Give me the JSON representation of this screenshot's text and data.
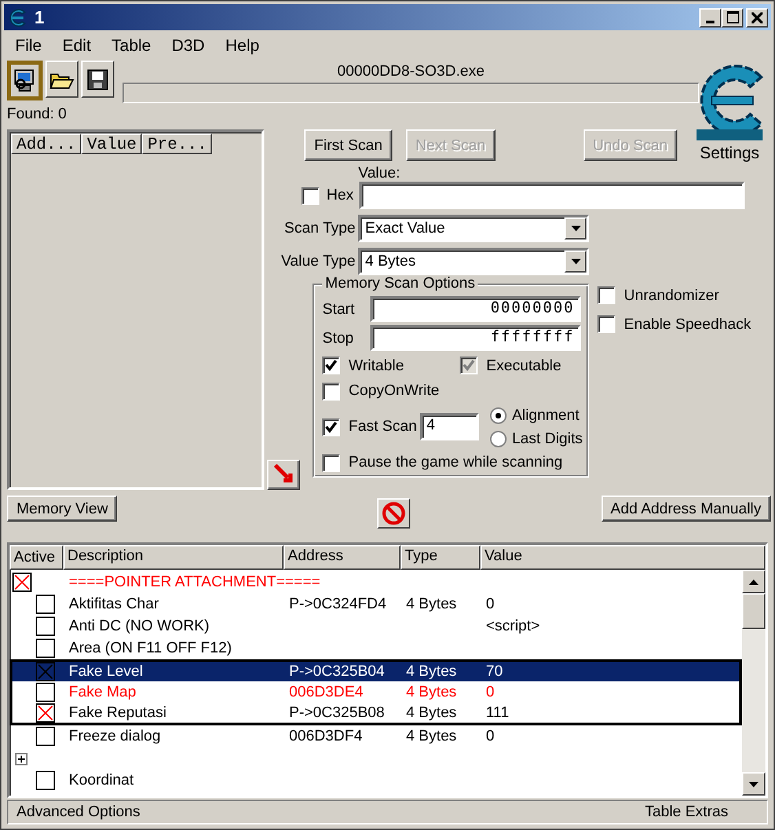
{
  "window": {
    "title": "1"
  },
  "menu": [
    "File",
    "Edit",
    "Table",
    "D3D",
    "Help"
  ],
  "toolbar_buttons": [
    {
      "kind": "process",
      "selected": true
    },
    {
      "kind": "open",
      "selected": false
    },
    {
      "kind": "save",
      "selected": false
    }
  ],
  "process_name": "00000DD8-SO3D.exe",
  "progress": {
    "level": 0
  },
  "found": "Found: 0",
  "settings": "Settings",
  "results_list": {
    "columns": [
      "Add...",
      "Value",
      "Pre..."
    ]
  },
  "scan_buttons": [
    {
      "label": "First Scan",
      "disabled": false
    },
    {
      "label": "Next Scan",
      "disabled": true
    },
    {
      "label": "Undo Scan",
      "disabled": true
    }
  ],
  "value": {
    "label": "Value:",
    "hex": {
      "label": "Hex",
      "checked": false
    }
  },
  "scan_type": {
    "label": "Scan Type",
    "value": "Exact Value"
  },
  "value_type": {
    "label": "Value Type",
    "value": "4 Bytes"
  },
  "memory_scan_options": {
    "title": "Memory Scan Options",
    "start": {
      "label": "Start",
      "value": "00000000"
    },
    "stop": {
      "label": "Stop",
      "value": "ffffffff"
    },
    "writable": {
      "label": "Writable",
      "checked": true,
      "disabled": false
    },
    "executable": {
      "label": "Executable",
      "checked": true,
      "disabled": true
    },
    "copy_on_write": {
      "label": "CopyOnWrite",
      "checked": false,
      "disabled": false
    },
    "fast_scan": {
      "label": "Fast Scan",
      "checked": true,
      "disabled": false,
      "value": "4"
    },
    "alignment": [
      {
        "label": "Alignment",
        "selected": true
      },
      {
        "label": "Last Digits",
        "selected": false
      }
    ],
    "pause": {
      "label": "Pause the game while scanning",
      "checked": false,
      "disabled": false
    }
  },
  "side_options": [
    {
      "label": "Unrandomizer",
      "checked": false
    },
    {
      "label": "Enable Speedhack",
      "checked": false
    }
  ],
  "memory_view_button": "Memory View",
  "add_address_button": "Add Address Manually",
  "table": {
    "columns": [
      "Active",
      "Description",
      "Address",
      "Type",
      "Value"
    ],
    "rows": [
      {
        "kind": "header",
        "active": true,
        "description": "====POINTER ATTACHMENT=====",
        "color": "#ff0000",
        "selected": false,
        "framed": false,
        "children": [
          {
            "kind": "item",
            "active": false,
            "description": "Aktifitas Char",
            "address": "P->0C324FD4",
            "type": "4 Bytes",
            "value": "0",
            "color": "#000000",
            "selected": false,
            "framed": false
          },
          {
            "kind": "item",
            "active": false,
            "description": "Anti DC (NO WORK)",
            "value": "<script>",
            "color": "#000000",
            "selected": false,
            "framed": false
          },
          {
            "kind": "item",
            "active": false,
            "description": "Area (ON F11 OFF F12)",
            "color": "#000000",
            "selected": false,
            "framed": false
          },
          {
            "kind": "item",
            "active": true,
            "description": "Fake Level",
            "address": "P->0C325B04",
            "type": "4 Bytes",
            "value": "70",
            "color": "#000000",
            "selected": true,
            "framed": true
          },
          {
            "kind": "item",
            "active": false,
            "description": "Fake Map",
            "address": "006D3DE4",
            "type": "4 Bytes",
            "value": "0",
            "color": "#ff0000",
            "selected": false,
            "framed": true
          },
          {
            "kind": "item",
            "active": true,
            "description": "Fake Reputasi",
            "address": "P->0C325B08",
            "type": "4 Bytes",
            "value": "111",
            "color": "#000000",
            "selected": false,
            "framed": true
          },
          {
            "kind": "item",
            "active": false,
            "description": "Freeze dialog",
            "address": "006D3DF4",
            "type": "4 Bytes",
            "value": "0",
            "color": "#000000",
            "selected": false,
            "framed": false
          }
        ]
      },
      {
        "kind": "folder",
        "expanded": false,
        "selected": false,
        "framed": false
      },
      {
        "kind": "item",
        "active": false,
        "description": "Koordinat",
        "color": "#000000",
        "selected": false,
        "framed": false
      }
    ]
  },
  "status_bar": {
    "left": "Advanced Options",
    "right": "Table Extras"
  }
}
